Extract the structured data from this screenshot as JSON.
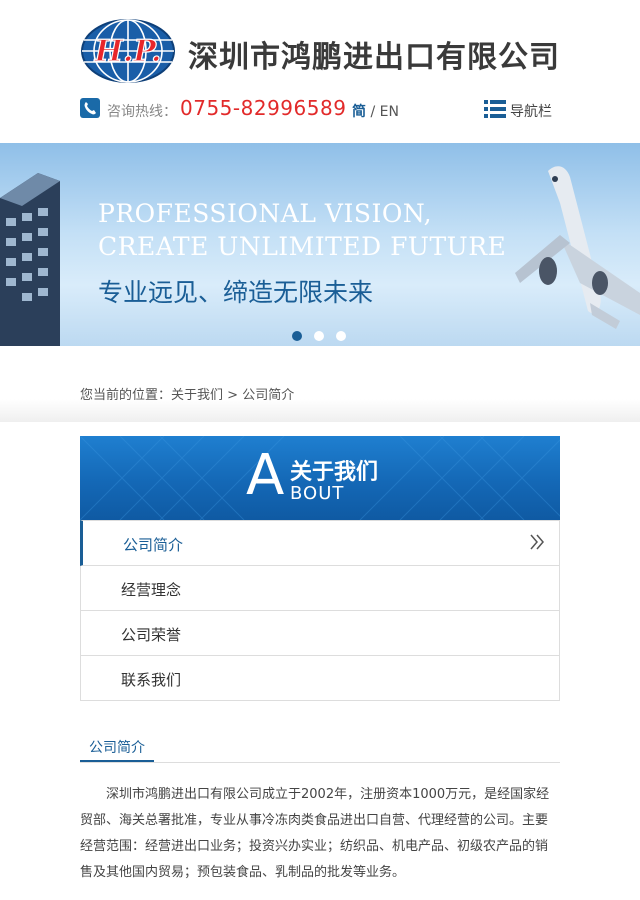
{
  "header": {
    "logo_initials": "H.P.",
    "company_name": "深圳市鸿鹏进出口有限公司",
    "hotline_label": "咨询热线：",
    "hotline_number": "0755-82996589",
    "lang_zh": "简",
    "lang_sep": "/",
    "lang_en": "EN",
    "nav_label": "导航栏"
  },
  "banner": {
    "line_en_1": "PROFESSIONAL VISION,",
    "line_en_2": "CREATE UNLIMITED FUTURE",
    "line_zh": "专业远见、缔造无限未来"
  },
  "breadcrumb": {
    "prefix": "您当前的位置：",
    "level1": "关于我们",
    "sep": ">",
    "level2": "公司简介"
  },
  "about": {
    "big_letter": "A",
    "title_zh": "关于我们",
    "title_en": "BOUT"
  },
  "menu": {
    "items": [
      {
        "label": "公司简介"
      },
      {
        "label": "经营理念"
      },
      {
        "label": "公司荣誉"
      },
      {
        "label": "联系我们"
      }
    ]
  },
  "section": {
    "title": "公司简介",
    "body": "深圳市鸿鹏进出口有限公司成立于2002年，注册资本1000万元，是经国家经贸部、海关总署批准，专业从事冷冻肉类食品进出口自营、代理经营的公司。主要经营范围：经营进出口业务；投资兴办实业；纺织品、机电产品、初级农产品的销售及其他国内贸易；预包装食品、乳制品的批发等业务。"
  },
  "colors": {
    "brand_blue": "#1a5e96",
    "hotline_red": "#e22a2a"
  }
}
